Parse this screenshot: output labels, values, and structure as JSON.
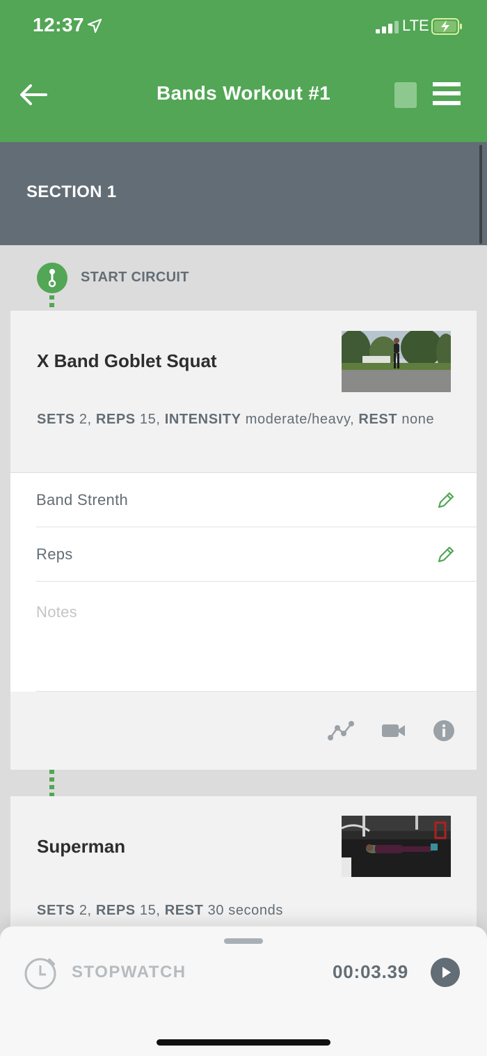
{
  "status_bar": {
    "time": "12:37",
    "network": "LTE"
  },
  "nav": {
    "title": "Bands Workout #1",
    "back_icon": "arrow-left-icon",
    "menu_icon": "hamburger-menu-icon"
  },
  "section": {
    "title": "SECTION 1"
  },
  "circuit": {
    "label": "START CIRCUIT"
  },
  "exercises": [
    {
      "name": "X Band Goblet Squat",
      "meta": [
        {
          "label": "SETS",
          "value": "2,"
        },
        {
          "label": "REPS",
          "value": "15,"
        },
        {
          "label": "INTENSITY",
          "value": "moderate/heavy,"
        },
        {
          "label": "REST",
          "value": "none"
        }
      ],
      "fields": [
        {
          "label": "Band Strenth"
        },
        {
          "label": "Reps"
        }
      ],
      "notes_placeholder": "Notes",
      "tools": [
        "progress-chart-icon",
        "video-camera-icon",
        "info-icon"
      ]
    },
    {
      "name": "Superman",
      "meta": [
        {
          "label": "SETS",
          "value": "2,"
        },
        {
          "label": "REPS",
          "value": "15,"
        },
        {
          "label": "REST",
          "value": "30 seconds"
        }
      ]
    }
  ],
  "stopwatch": {
    "label": "STOPWATCH",
    "time": "00:03.39"
  },
  "colors": {
    "brand_green": "#52a655",
    "section_gray": "#636d75"
  }
}
